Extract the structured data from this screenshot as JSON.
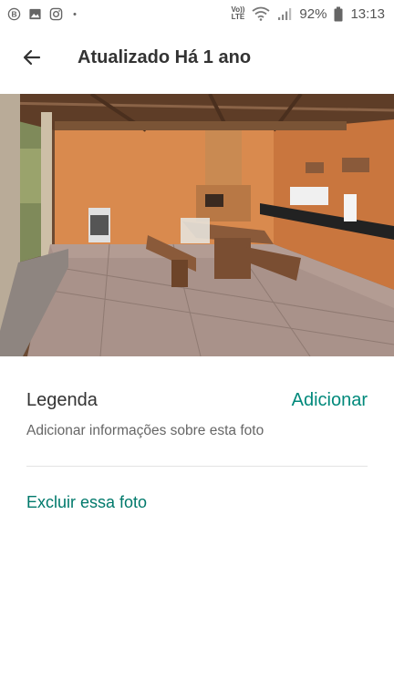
{
  "status_bar": {
    "battery": "92%",
    "time": "13:13",
    "network_top": "Vo))",
    "network_bottom": "LTE",
    "icons": [
      "b-badge-icon",
      "image-icon",
      "instagram-icon",
      "dot-icon",
      "wifi-icon",
      "signal-icon",
      "battery-icon"
    ]
  },
  "app_bar": {
    "title": "Atualizado Há 1 ano",
    "back_icon": "arrow-left-icon"
  },
  "photo": {
    "edit_icon": "pencil-icon"
  },
  "caption": {
    "label": "Legenda",
    "action": "Adicionar",
    "hint": "Adicionar informações sobre esta foto"
  },
  "actions": {
    "delete": "Excluir essa foto"
  },
  "colors": {
    "accent": "#00897b",
    "accent_dark": "#00796b"
  }
}
